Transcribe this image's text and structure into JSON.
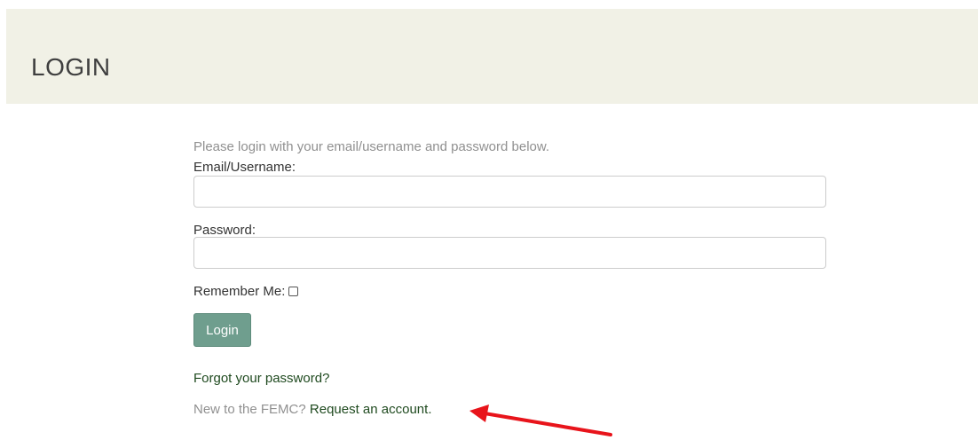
{
  "header": {
    "title": "LOGIN",
    "background": "#f1f1e6"
  },
  "form": {
    "intro": "Please login with your email/username and password below.",
    "email_label": "Email/Username:",
    "email_value": "",
    "password_label": "Password:",
    "password_value": "",
    "remember_label": "Remember Me:",
    "remember_checked": false,
    "login_button": "Login",
    "forgot_link": "Forgot your password?",
    "new_text": "New to the FEMC?",
    "request_link": "Request an account."
  },
  "colors": {
    "accent_button": "#6f9e8e",
    "link": "#1f4a1f",
    "annotation_arrow": "#e8141b"
  }
}
